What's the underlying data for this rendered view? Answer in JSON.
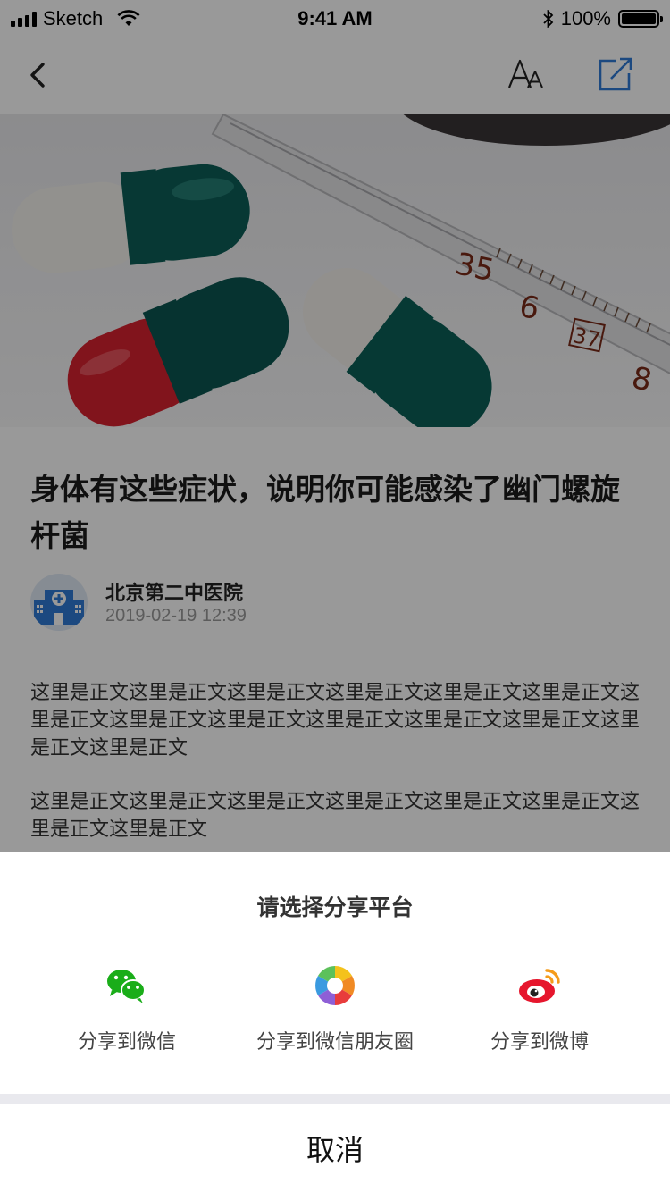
{
  "status_bar": {
    "carrier": "Sketch",
    "time": "9:41 AM",
    "battery": "100%"
  },
  "nav": {
    "back_icon": "chevron-left-icon",
    "font_icon": "font-size-icon",
    "share_icon": "share-square-icon"
  },
  "article": {
    "title": "身体有这些症状，说明你可能感染了幽门螺旋杆菌",
    "author": "北京第二中医院",
    "datetime": "2019-02-19 12:39",
    "paragraphs": [
      "这里是正文这里是正文这里是正文这里是正文这里是正文这里是正文这里是正文这里是正文这里是正文这里是正文这里是正文这里是正文这里是正文这里是正文",
      "这里是正文这里是正文这里是正文这里是正文这里是正文这里是正文这里是正文这里是正文"
    ]
  },
  "share_sheet": {
    "title": "请选择分享平台",
    "options": [
      {
        "label": "分享到微信",
        "icon": "wechat-icon",
        "color": "#1aad19"
      },
      {
        "label": "分享到微信朋友圈",
        "icon": "moments-icon",
        "color": "#3a9ae0"
      },
      {
        "label": "分享到微博",
        "icon": "weibo-icon",
        "color": "#e6162d"
      }
    ],
    "cancel": "取消"
  },
  "colors": {
    "accent_blue": "#2f7ad6",
    "overlay": "rgba(0,0,0,0.40)"
  }
}
